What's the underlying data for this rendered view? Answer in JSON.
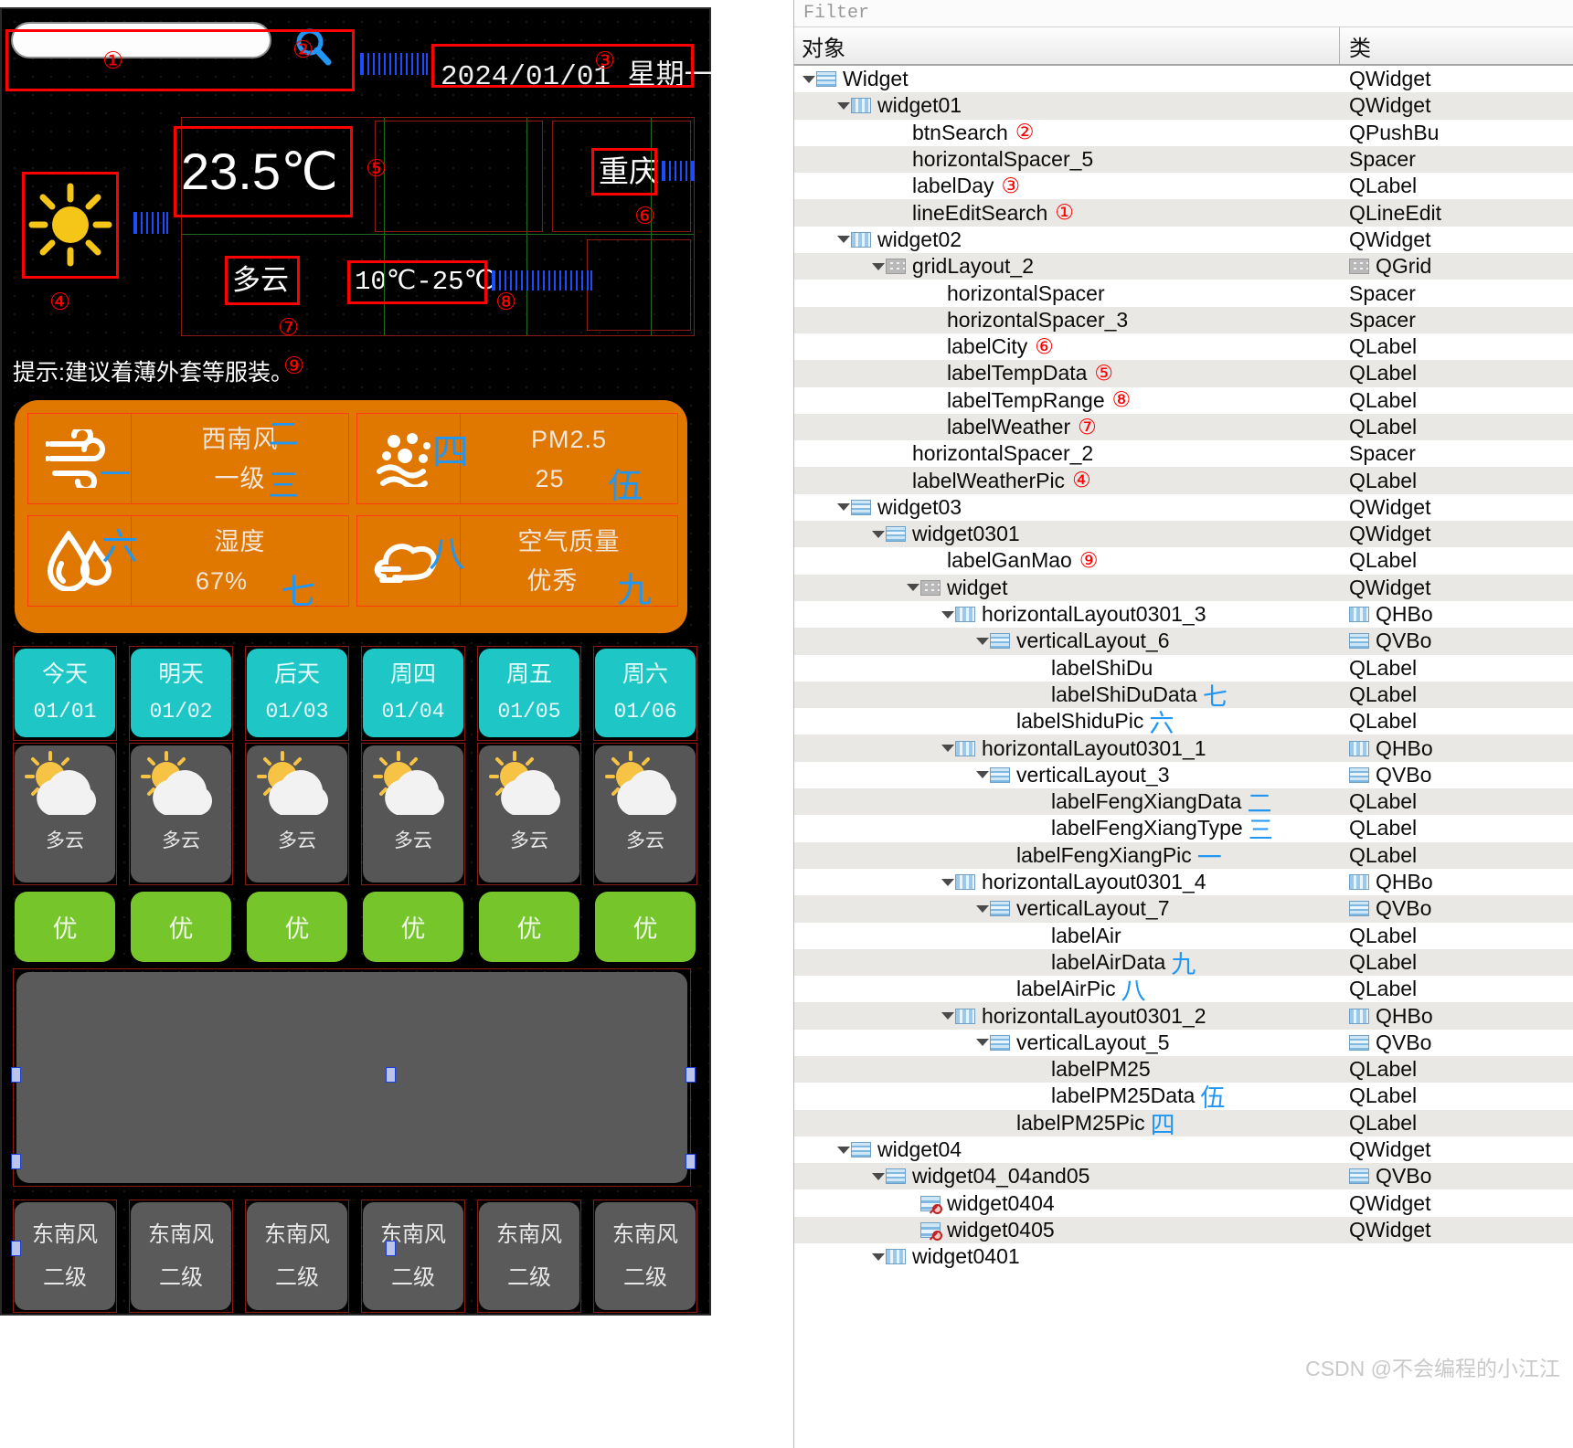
{
  "form": {
    "search": {
      "value": "",
      "placeholder": "",
      "marker": "①"
    },
    "search_button": {
      "icon": "search-icon",
      "marker": "②"
    },
    "day_label": {
      "text": "2024/01/01 星期一",
      "marker": "③"
    },
    "weather_pic": {
      "icon": "sun-icon",
      "marker": "④"
    },
    "temp_data": {
      "text": "23.5℃",
      "marker": "⑤"
    },
    "city": {
      "text": "重庆",
      "marker": "⑥"
    },
    "weather": {
      "text": "多云",
      "marker": "⑦"
    },
    "temp_range": {
      "text": "10℃-25℃",
      "marker": "⑧"
    },
    "ganmao": {
      "text": "提示:建议着薄外套等服装。",
      "marker": "⑨"
    },
    "info_cards": [
      {
        "icon": "wind-icon",
        "icon_marker": "一",
        "line1": "西南风",
        "line1_marker": "二",
        "line2": "一级",
        "line2_marker": "三"
      },
      {
        "icon": "pm25-icon",
        "icon_marker": "四",
        "line1": "PM2.5",
        "line1_marker": "",
        "line2": "25",
        "line2_marker": "伍"
      },
      {
        "icon": "humidity-icon",
        "icon_marker": "六",
        "line1": "湿度",
        "line1_marker": "",
        "line2": "67%",
        "line2_marker": "七"
      },
      {
        "icon": "air-quality-icon",
        "icon_marker": "八",
        "line1": "空气质量",
        "line1_marker": "",
        "line2": "优秀",
        "line2_marker": "九"
      }
    ],
    "forecast": {
      "days": [
        {
          "name": "今天",
          "date": "01/01",
          "weather": "多云",
          "quality": "优",
          "wind_dir": "东南风",
          "wind_level": "二级"
        },
        {
          "name": "明天",
          "date": "01/02",
          "weather": "多云",
          "quality": "优",
          "wind_dir": "东南风",
          "wind_level": "二级"
        },
        {
          "name": "后天",
          "date": "01/03",
          "weather": "多云",
          "quality": "优",
          "wind_dir": "东南风",
          "wind_level": "二级"
        },
        {
          "name": "周四",
          "date": "01/04",
          "weather": "多云",
          "quality": "优",
          "wind_dir": "东南风",
          "wind_level": "二级"
        },
        {
          "name": "周五",
          "date": "01/05",
          "weather": "多云",
          "quality": "优",
          "wind_dir": "东南风",
          "wind_level": "二级"
        },
        {
          "name": "周六",
          "date": "01/06",
          "weather": "多云",
          "quality": "优",
          "wind_dir": "东南风",
          "wind_level": "二级"
        }
      ]
    },
    "colors": {
      "background": "#000000",
      "orange_card": "#e07800",
      "day_card": "#1fc6c6",
      "quality_card": "#76c62b",
      "panel_gray": "#5a5a5a",
      "marker_red": "#ff0000",
      "marker_blue": "#2196f3"
    }
  },
  "inspector": {
    "filter_placeholder": "Filter",
    "columns": {
      "object": "对象",
      "class": "类"
    },
    "watermark": "CSDN @不会编程的小江江",
    "rows": [
      {
        "name": "Widget",
        "cls": "QWidget",
        "indent": 1,
        "arrow": true,
        "icon": "vwidget",
        "mark": "",
        "mark_color": ""
      },
      {
        "name": "widget01",
        "cls": "QWidget",
        "indent": 2,
        "arrow": true,
        "icon": "hlayout",
        "mark": "",
        "mark_color": ""
      },
      {
        "name": "btnSearch",
        "cls": "QPushBu",
        "indent": 3,
        "arrow": false,
        "icon": "",
        "mark": "②",
        "mark_color": "red"
      },
      {
        "name": "horizontalSpacer_5",
        "cls": "Spacer",
        "indent": 3,
        "arrow": false,
        "icon": "",
        "mark": "",
        "mark_color": ""
      },
      {
        "name": "labelDay",
        "cls": "QLabel",
        "indent": 3,
        "arrow": false,
        "icon": "",
        "mark": "③",
        "mark_color": "red"
      },
      {
        "name": "lineEditSearch",
        "cls": "QLineEdit",
        "indent": 3,
        "arrow": false,
        "icon": "",
        "mark": "①",
        "mark_color": "red"
      },
      {
        "name": "widget02",
        "cls": "QWidget",
        "indent": 2,
        "arrow": true,
        "icon": "hlayout",
        "mark": "",
        "mark_color": ""
      },
      {
        "name": "gridLayout_2",
        "cls": "QGrid",
        "indent": 3,
        "arrow": true,
        "icon": "grid",
        "mark": "",
        "mark_color": "",
        "cls_icon": "grid"
      },
      {
        "name": "horizontalSpacer",
        "cls": "Spacer",
        "indent": 4,
        "arrow": false,
        "icon": "",
        "mark": "",
        "mark_color": ""
      },
      {
        "name": "horizontalSpacer_3",
        "cls": "Spacer",
        "indent": 4,
        "arrow": false,
        "icon": "",
        "mark": "",
        "mark_color": ""
      },
      {
        "name": "labelCity",
        "cls": "QLabel",
        "indent": 4,
        "arrow": false,
        "icon": "",
        "mark": "⑥",
        "mark_color": "red"
      },
      {
        "name": "labelTempData",
        "cls": "QLabel",
        "indent": 4,
        "arrow": false,
        "icon": "",
        "mark": "⑤",
        "mark_color": "red"
      },
      {
        "name": "labelTempRange",
        "cls": "QLabel",
        "indent": 4,
        "arrow": false,
        "icon": "",
        "mark": "⑧",
        "mark_color": "red"
      },
      {
        "name": "labelWeather",
        "cls": "QLabel",
        "indent": 4,
        "arrow": false,
        "icon": "",
        "mark": "⑦",
        "mark_color": "red"
      },
      {
        "name": "horizontalSpacer_2",
        "cls": "Spacer",
        "indent": 3,
        "arrow": false,
        "icon": "",
        "mark": "",
        "mark_color": ""
      },
      {
        "name": "labelWeatherPic",
        "cls": "QLabel",
        "indent": 3,
        "arrow": false,
        "icon": "",
        "mark": "④",
        "mark_color": "red"
      },
      {
        "name": "widget03",
        "cls": "QWidget",
        "indent": 2,
        "arrow": true,
        "icon": "vwidget",
        "mark": "",
        "mark_color": ""
      },
      {
        "name": "widget0301",
        "cls": "QWidget",
        "indent": 3,
        "arrow": true,
        "icon": "vwidget",
        "mark": "",
        "mark_color": ""
      },
      {
        "name": "labelGanMao",
        "cls": "QLabel",
        "indent": 4,
        "arrow": false,
        "icon": "",
        "mark": "⑨",
        "mark_color": "red"
      },
      {
        "name": "widget",
        "cls": "QWidget",
        "indent": 4,
        "arrow": true,
        "icon": "grid",
        "mark": "",
        "mark_color": ""
      },
      {
        "name": "horizontalLayout0301_3",
        "cls": "QHBo",
        "indent": 5,
        "arrow": true,
        "icon": "hlayout",
        "mark": "",
        "mark_color": "",
        "cls_icon": "hlayout"
      },
      {
        "name": "verticalLayout_6",
        "cls": "QVBo",
        "indent": 6,
        "arrow": true,
        "icon": "vwidget",
        "mark": "",
        "mark_color": "",
        "cls_icon": "vwidget"
      },
      {
        "name": "labelShiDu",
        "cls": "QLabel",
        "indent": 7,
        "arrow": false,
        "icon": "",
        "mark": "",
        "mark_color": ""
      },
      {
        "name": "labelShiDuData",
        "cls": "QLabel",
        "indent": 7,
        "arrow": false,
        "icon": "",
        "mark": "七",
        "mark_color": "blue"
      },
      {
        "name": "labelShiduPic",
        "cls": "QLabel",
        "indent": 6,
        "arrow": false,
        "icon": "",
        "mark": "六",
        "mark_color": "blue"
      },
      {
        "name": "horizontalLayout0301_1",
        "cls": "QHBo",
        "indent": 5,
        "arrow": true,
        "icon": "hlayout",
        "mark": "",
        "mark_color": "",
        "cls_icon": "hlayout"
      },
      {
        "name": "verticalLayout_3",
        "cls": "QVBo",
        "indent": 6,
        "arrow": true,
        "icon": "vwidget",
        "mark": "",
        "mark_color": "",
        "cls_icon": "vwidget"
      },
      {
        "name": "labelFengXiangData",
        "cls": "QLabel",
        "indent": 7,
        "arrow": false,
        "icon": "",
        "mark": "二",
        "mark_color": "blue"
      },
      {
        "name": "labelFengXiangType",
        "cls": "QLabel",
        "indent": 7,
        "arrow": false,
        "icon": "",
        "mark": "三",
        "mark_color": "blue"
      },
      {
        "name": "labelFengXiangPic",
        "cls": "QLabel",
        "indent": 6,
        "arrow": false,
        "icon": "",
        "mark": "一",
        "mark_color": "blue"
      },
      {
        "name": "horizontalLayout0301_4",
        "cls": "QHBo",
        "indent": 5,
        "arrow": true,
        "icon": "hlayout",
        "mark": "",
        "mark_color": "",
        "cls_icon": "hlayout"
      },
      {
        "name": "verticalLayout_7",
        "cls": "QVBo",
        "indent": 6,
        "arrow": true,
        "icon": "vwidget",
        "mark": "",
        "mark_color": "",
        "cls_icon": "vwidget"
      },
      {
        "name": "labelAir",
        "cls": "QLabel",
        "indent": 7,
        "arrow": false,
        "icon": "",
        "mark": "",
        "mark_color": ""
      },
      {
        "name": "labelAirData",
        "cls": "QLabel",
        "indent": 7,
        "arrow": false,
        "icon": "",
        "mark": "九",
        "mark_color": "blue"
      },
      {
        "name": "labelAirPic",
        "cls": "QLabel",
        "indent": 6,
        "arrow": false,
        "icon": "",
        "mark": "八",
        "mark_color": "blue"
      },
      {
        "name": "horizontalLayout0301_2",
        "cls": "QHBo",
        "indent": 5,
        "arrow": true,
        "icon": "hlayout",
        "mark": "",
        "mark_color": "",
        "cls_icon": "hlayout"
      },
      {
        "name": "verticalLayout_5",
        "cls": "QVBo",
        "indent": 6,
        "arrow": true,
        "icon": "vwidget",
        "mark": "",
        "mark_color": "",
        "cls_icon": "vwidget"
      },
      {
        "name": "labelPM25",
        "cls": "QLabel",
        "indent": 7,
        "arrow": false,
        "icon": "",
        "mark": "",
        "mark_color": ""
      },
      {
        "name": "labelPM25Data",
        "cls": "QLabel",
        "indent": 7,
        "arrow": false,
        "icon": "",
        "mark": "伍",
        "mark_color": "blue"
      },
      {
        "name": "labelPM25Pic",
        "cls": "QLabel",
        "indent": 6,
        "arrow": false,
        "icon": "",
        "mark": "四",
        "mark_color": "blue"
      },
      {
        "name": "widget04",
        "cls": "QWidget",
        "indent": 2,
        "arrow": true,
        "icon": "vwidget",
        "mark": "",
        "mark_color": ""
      },
      {
        "name": "widget04_04and05",
        "cls": "QVBo",
        "indent": 3,
        "arrow": true,
        "icon": "vwidget",
        "mark": "",
        "mark_color": "",
        "cls_icon": "vwidget"
      },
      {
        "name": "widget0404",
        "cls": "QWidget",
        "indent": 4,
        "arrow": false,
        "icon": "nolayout",
        "mark": "",
        "mark_color": ""
      },
      {
        "name": "widget0405",
        "cls": "QWidget",
        "indent": 4,
        "arrow": false,
        "icon": "nolayout",
        "mark": "",
        "mark_color": ""
      },
      {
        "name": "widget0401",
        "cls": "",
        "indent": 3,
        "arrow": true,
        "icon": "hlayout",
        "mark": "",
        "mark_color": ""
      }
    ]
  }
}
